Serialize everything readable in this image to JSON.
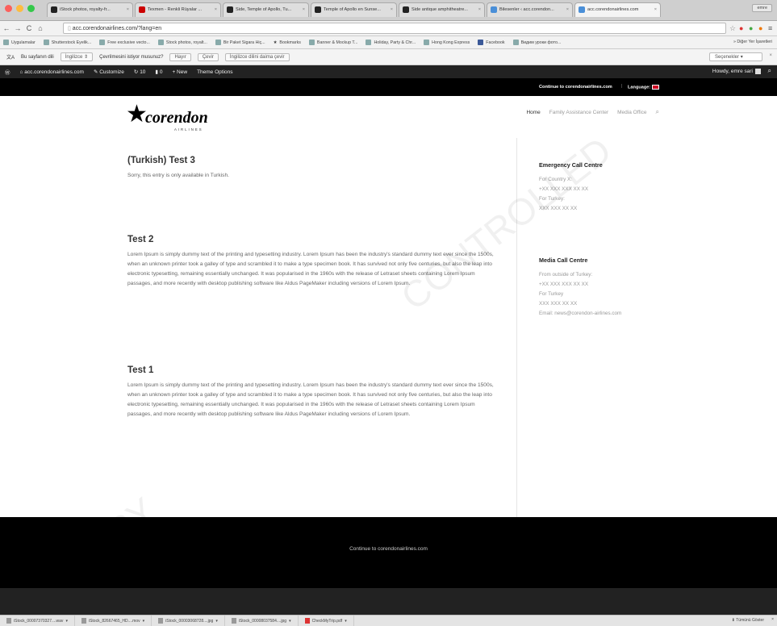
{
  "browser": {
    "tabs": [
      {
        "title": "iStock photos, royalty-fr...",
        "fav_color": "#222"
      },
      {
        "title": "Texmen - Renkli Rüyalar ...",
        "fav_color": "#cc0000"
      },
      {
        "title": "Side, Temple of Apollo, Tu...",
        "fav_color": "#222"
      },
      {
        "title": "Temple of Apollo en Sunse...",
        "fav_color": "#222"
      },
      {
        "title": "Side antique amphitheatre...",
        "fav_color": "#222"
      },
      {
        "title": "Bilesenler ‹ acc.corendon...",
        "fav_color": "#4a8fd8"
      },
      {
        "title": "acc.corendonairlines.com",
        "fav_color": "#4a8fd8"
      }
    ],
    "user_button": "emre",
    "url": "acc.corendonairlines.com/?lang=en",
    "bookmarks": [
      "Uygulamalar",
      "Shutterstock Eyelik...",
      "Free exclusive vecto...",
      "Stock photos, royalt...",
      "Bir Paket Sigara Hiç...",
      "Bookmarks",
      "Banner & Mockup T...",
      "Holiday, Party & Chr...",
      "Hong Kong Express",
      "Facebook",
      "Видим уроки фото..."
    ],
    "bookmarks_other": "Diğer Yer İşaretleri",
    "translate": {
      "label": "Bu sayfanın dili",
      "lang": "İngilizce",
      "question": "Çevrilmesini istiyor musunuz?",
      "no": "Hayır",
      "translate": "Çevir",
      "never": "İngilizce dilini daima çevir",
      "options": "Seçenekler"
    }
  },
  "adminbar": {
    "site": "acc.corendonairlines.com",
    "customize": "Customize",
    "updates": "10",
    "comments": "0",
    "new": "New",
    "theme_options": "Theme Options",
    "howdy": "Howdy, emre sari"
  },
  "topbar": {
    "continue": "Continue to corendonairlines.com",
    "language": "Language:"
  },
  "logo": {
    "word": "corendon",
    "sub": "AIRLINES"
  },
  "menu": [
    "Home",
    "Family Assistance Center",
    "Media Office"
  ],
  "posts": [
    {
      "title": "(Turkish) Test 3",
      "body": "Sorry, this entry is only available in Turkish."
    },
    {
      "title": "Test 2",
      "body": "Lorem Ipsum is simply dummy text of the printing and typesetting industry. Lorem Ipsum has been the industry's standard dummy text ever since the 1500s, when an unknown printer took a galley of type and scrambled it to make a type specimen book. It has survived not only five centuries, but also the leap into electronic typesetting, remaining essentially unchanged. It was popularised in the 1960s with the release of Letraset sheets containing Lorem Ipsum passages, and more recently with desktop publishing software like Aldus PageMaker including versions of Lorem Ipsum."
    },
    {
      "title": "Test 1",
      "body": "Lorem Ipsum is simply dummy text of the printing and typesetting industry. Lorem Ipsum has been the industry's standard dummy text ever since the 1500s, when an unknown printer took a galley of type and scrambled it to make a type specimen book. It has survived not only five centuries, but also the leap into electronic typesetting, remaining essentially unchanged. It was popularised in the 1960s with the release of Letraset sheets containing Lorem Ipsum passages, and more recently with desktop publishing software like Aldus PageMaker including versions of Lorem Ipsum."
    }
  ],
  "sidebar": {
    "emergency": {
      "title": "Emergency Call Centre",
      "lines": [
        "For Country X:",
        "+XX XXX XXX XX XX",
        "For Turkey:",
        "XXX XXX XX XX"
      ]
    },
    "media": {
      "title": "Media Call Centre",
      "lines": [
        "From outside of Turkey:",
        "+XX XXX XXX XX XX",
        "For Turkey",
        "XXX XXX XX XX",
        "Email: news@corendon-airlines.com"
      ]
    }
  },
  "footer": {
    "continue": "Continue to corendonairlines.com"
  },
  "downloads": {
    "items": [
      "iStock_00007370327....wav",
      "iStock_82667465_HD....mov",
      "iStock_00003068728....jpg",
      "iStock_00008037584....jpg",
      "CheckMyTrip.pdf"
    ],
    "show_all": "Tümünü Göster"
  },
  "watermarks": [
    "CONTROLLED",
    "COPY",
    "CO"
  ],
  "colors": {
    "admin_bar": "#222222",
    "top_bar": "#000000",
    "footer": "#000000",
    "link_muted": "#999999"
  }
}
